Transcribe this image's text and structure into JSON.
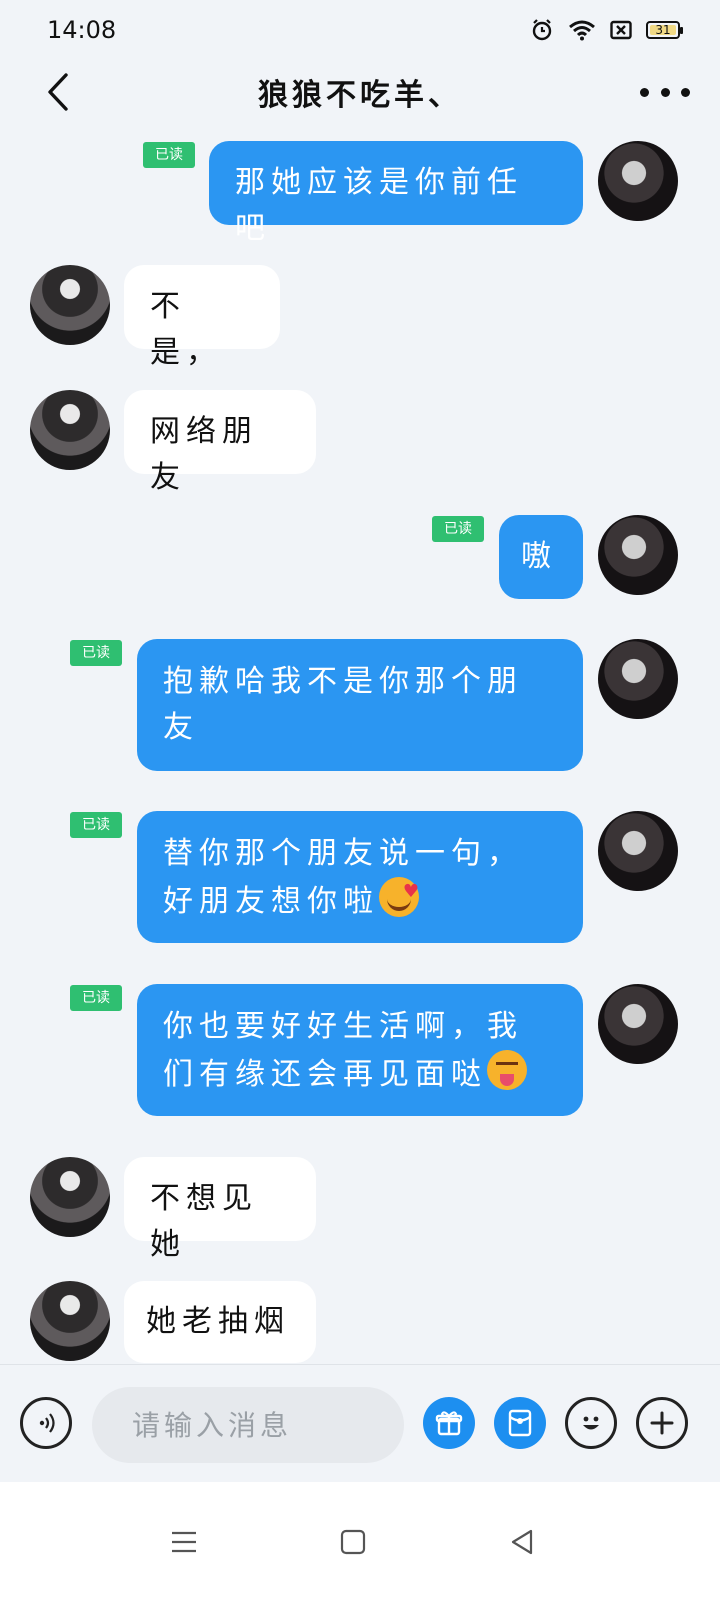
{
  "status": {
    "time": "14:08",
    "battery": "31"
  },
  "header": {
    "title": "狼狼不吃羊、"
  },
  "messages": [
    {
      "side": "right",
      "text": "那她应该是你前任吧",
      "read_label": "已读"
    },
    {
      "side": "left",
      "text": "不是，"
    },
    {
      "side": "left",
      "text": "网络朋友"
    },
    {
      "side": "right",
      "text": "嗷",
      "read_label": "已读"
    },
    {
      "side": "right",
      "line1": "抱歉哈我不是你那个朋",
      "line2": "友",
      "read_label": "已读"
    },
    {
      "side": "right",
      "line1": "替你那个朋友说一句，",
      "line2": "好朋友想你啦",
      "emoji": "smiling-face-with-hearts",
      "read_label": "已读"
    },
    {
      "side": "right",
      "line1": "你也要好好生活啊，我",
      "line2": "们有缘还会再见面哒",
      "emoji": "squinting-face-with-tongue",
      "read_label": "已读"
    },
    {
      "side": "left",
      "text": "不想见她"
    },
    {
      "side": "left",
      "text": "她老抽烟"
    }
  ],
  "composer": {
    "placeholder": "请输入消息"
  },
  "colors": {
    "accent": "#2b96f2",
    "read_badge": "#2fbf71",
    "background": "#f1f4f8"
  }
}
